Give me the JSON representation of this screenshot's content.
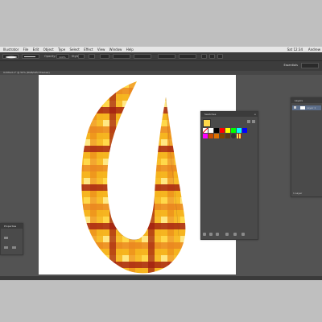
{
  "menubar": {
    "items": [
      "Illustrator",
      "File",
      "Edit",
      "Object",
      "Type",
      "Select",
      "Effect",
      "View",
      "Window",
      "Help"
    ],
    "clock": "Sat 12:34",
    "user": "Andrew"
  },
  "control_bar": {
    "stroke_label": "Stroke:",
    "stroke_value": "1 pt",
    "opacity_label": "Opacity:",
    "opacity_value": "100%",
    "style_label": "Style:",
    "basic_label": "Basic"
  },
  "workspace": {
    "name": "Essentials"
  },
  "document": {
    "tab_title": "Untitled-1* @ 50% (RGB/GPU Preview)"
  },
  "swatches_panel": {
    "title": "Swatches",
    "colors": [
      "#ffffff",
      "#000000",
      "#ff0000",
      "#ffff00",
      "#00ff00",
      "#00ffff",
      "#0000ff",
      "#ff00ff",
      "#c84b00",
      "#e07000",
      "#f0a000",
      "#804000",
      "#5a3a1a",
      "#ffd24a"
    ]
  },
  "layers_panel": {
    "title": "Layers",
    "layer_name": "Layer 1",
    "count": "1 Layer"
  },
  "left_panel": {
    "title": "Properties"
  },
  "artwork": {
    "colors": {
      "dark_red": "#a21c0e",
      "orange": "#e8801c",
      "gold": "#f6b21c",
      "yellow": "#ffd84a",
      "pale_yellow": "#ffe98a"
    }
  }
}
